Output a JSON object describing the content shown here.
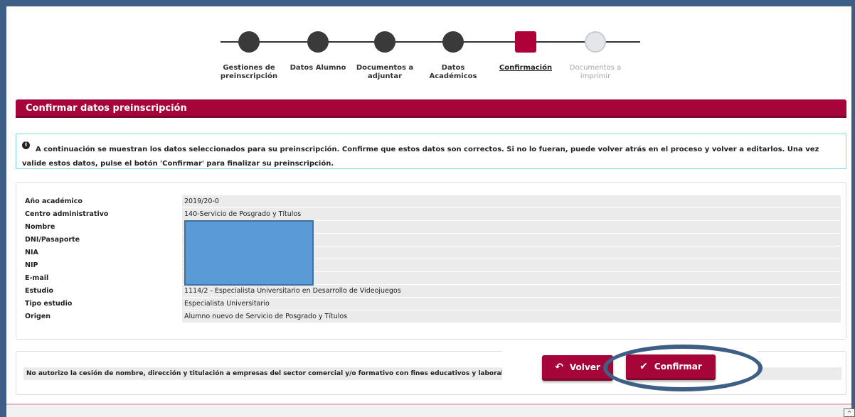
{
  "stepper": {
    "steps": [
      {
        "label": "Gestiones de preinscripción",
        "state": "done"
      },
      {
        "label": "Datos Alumno",
        "state": "done"
      },
      {
        "label": "Documentos a adjuntar",
        "state": "done"
      },
      {
        "label": "Datos Académicos",
        "state": "done"
      },
      {
        "label": "Confirmación",
        "state": "current"
      },
      {
        "label": "Documentos a imprimir",
        "state": "pending"
      }
    ]
  },
  "section": {
    "title": "Confirmar datos preinscripción"
  },
  "info": {
    "icon": "info-icon",
    "text": "A continuación se muestran los datos seleccionados para su preinscripción. Confirme que estos datos son correctos. Si no lo fueran, puede volver atrás en el proceso y volver a editarlos. Una vez valide estos datos, pulse el botón 'Confirmar' para finalizar su preinscripción."
  },
  "data_rows": [
    {
      "label": "Año académico",
      "value": "2019/20-0"
    },
    {
      "label": "Centro administrativo",
      "value": "140-Servicio de Posgrado y Títulos"
    },
    {
      "label": "Nombre",
      "value": ""
    },
    {
      "label": "DNI/Pasaporte",
      "value": ""
    },
    {
      "label": "NIA",
      "value": ""
    },
    {
      "label": "NIP",
      "value": ""
    },
    {
      "label": "E-mail",
      "value": ""
    },
    {
      "label": "Estudio",
      "value": "1114/2 - Especialista Universitario en Desarrollo de Videojuegos"
    },
    {
      "label": "Tipo estudio",
      "value": "Especialista Universitario"
    },
    {
      "label": "Origen",
      "value": "Alumno nuevo de Servicio de Posgrado y Títulos"
    }
  ],
  "consent": {
    "text": "No autorizo la cesión de nombre, dirección y titulación a empresas del sector comercial y/o formativo con fines educativos y laborales"
  },
  "buttons": {
    "back_label": "Volver",
    "confirm_label": "Confirmar"
  },
  "colors": {
    "accent": "#a6053a",
    "frame": "#3d5f86",
    "info_border": "#7fdde8",
    "redaction": "#5b9bd5"
  }
}
